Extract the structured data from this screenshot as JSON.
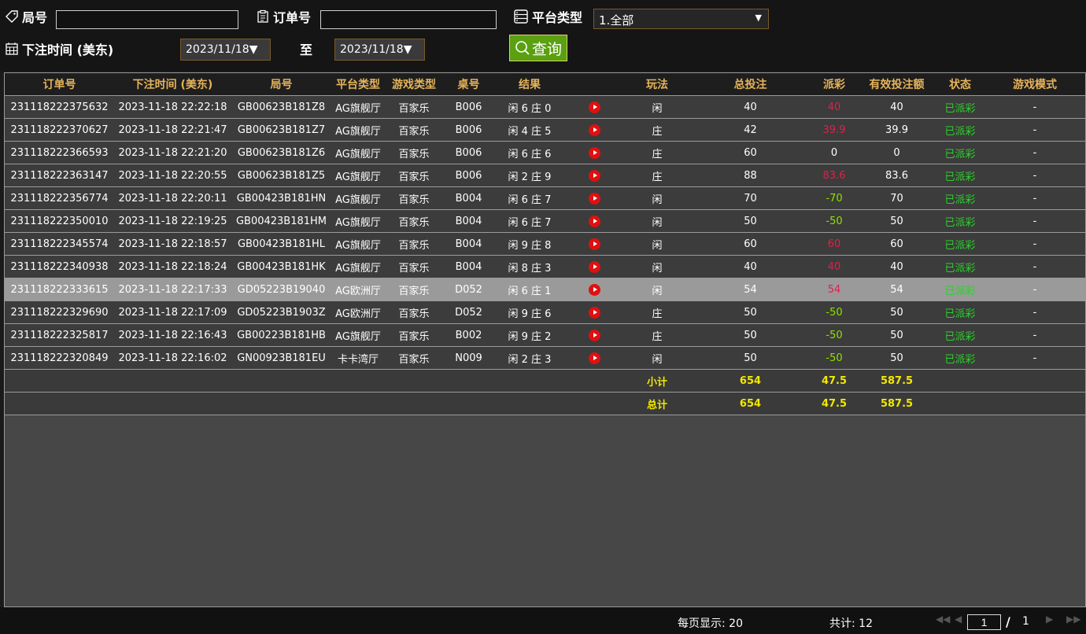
{
  "filters": {
    "round_label": "局号",
    "round_value": "",
    "order_label": "订单号",
    "order_value": "",
    "platform_label": "平台类型",
    "platform_selected": "1.全部",
    "time_label": "下注时间 (美东)",
    "date_from": "2023/11/18▼",
    "to_label": "至",
    "date_to": "2023/11/18▼",
    "query_label": "查询"
  },
  "columns": [
    "订单号",
    "下注时间 (美东)",
    "局号",
    "平台类型",
    "游戏类型",
    "桌号",
    "结果",
    "",
    "玩法",
    "总投注",
    "派彩",
    "有效投注额",
    "状态",
    "游戏模式"
  ],
  "rows": [
    {
      "order": "231118222375632",
      "time": "2023-11-18 22:22:18",
      "round": "GB00623B181Z8",
      "platform": "AG旗舰厅",
      "game": "百家乐",
      "table": "B006",
      "result": "闲 6 庄 0",
      "play": "闲",
      "bet": "40",
      "payout": "40",
      "valid": "40",
      "status": "已派彩",
      "mode": "-"
    },
    {
      "order": "231118222370627",
      "time": "2023-11-18 22:21:47",
      "round": "GB00623B181Z7",
      "platform": "AG旗舰厅",
      "game": "百家乐",
      "table": "B006",
      "result": "闲 4 庄 5",
      "play": "庄",
      "bet": "42",
      "payout": "39.9",
      "valid": "39.9",
      "status": "已派彩",
      "mode": "-"
    },
    {
      "order": "231118222366593",
      "time": "2023-11-18 22:21:20",
      "round": "GB00623B181Z6",
      "platform": "AG旗舰厅",
      "game": "百家乐",
      "table": "B006",
      "result": "闲 6 庄 6",
      "play": "庄",
      "bet": "60",
      "payout": "0",
      "valid": "0",
      "status": "已派彩",
      "mode": "-"
    },
    {
      "order": "231118222363147",
      "time": "2023-11-18 22:20:55",
      "round": "GB00623B181Z5",
      "platform": "AG旗舰厅",
      "game": "百家乐",
      "table": "B006",
      "result": "闲 2 庄 9",
      "play": "庄",
      "bet": "88",
      "payout": "83.6",
      "valid": "83.6",
      "status": "已派彩",
      "mode": "-"
    },
    {
      "order": "231118222356774",
      "time": "2023-11-18 22:20:11",
      "round": "GB00423B181HN",
      "platform": "AG旗舰厅",
      "game": "百家乐",
      "table": "B004",
      "result": "闲 6 庄 7",
      "play": "闲",
      "bet": "70",
      "payout": "-70",
      "valid": "70",
      "status": "已派彩",
      "mode": "-"
    },
    {
      "order": "231118222350010",
      "time": "2023-11-18 22:19:25",
      "round": "GB00423B181HM",
      "platform": "AG旗舰厅",
      "game": "百家乐",
      "table": "B004",
      "result": "闲 6 庄 7",
      "play": "闲",
      "bet": "50",
      "payout": "-50",
      "valid": "50",
      "status": "已派彩",
      "mode": "-"
    },
    {
      "order": "231118222345574",
      "time": "2023-11-18 22:18:57",
      "round": "GB00423B181HL",
      "platform": "AG旗舰厅",
      "game": "百家乐",
      "table": "B004",
      "result": "闲 9 庄 8",
      "play": "闲",
      "bet": "60",
      "payout": "60",
      "valid": "60",
      "status": "已派彩",
      "mode": "-"
    },
    {
      "order": "231118222340938",
      "time": "2023-11-18 22:18:24",
      "round": "GB00423B181HK",
      "platform": "AG旗舰厅",
      "game": "百家乐",
      "table": "B004",
      "result": "闲 8 庄 3",
      "play": "闲",
      "bet": "40",
      "payout": "40",
      "valid": "40",
      "status": "已派彩",
      "mode": "-"
    },
    {
      "order": "231118222333615",
      "time": "2023-11-18 22:17:33",
      "round": "GD05223B19040",
      "platform": "AG欧洲厅",
      "game": "百家乐",
      "table": "D052",
      "result": "闲 6 庄 1",
      "play": "闲",
      "bet": "54",
      "payout": "54",
      "valid": "54",
      "status": "已派彩",
      "mode": "-"
    },
    {
      "order": "231118222329690",
      "time": "2023-11-18 22:17:09",
      "round": "GD05223B1903Z",
      "platform": "AG欧洲厅",
      "game": "百家乐",
      "table": "D052",
      "result": "闲 9 庄 6",
      "play": "庄",
      "bet": "50",
      "payout": "-50",
      "valid": "50",
      "status": "已派彩",
      "mode": "-"
    },
    {
      "order": "231118222325817",
      "time": "2023-11-18 22:16:43",
      "round": "GB00223B181HB",
      "platform": "AG旗舰厅",
      "game": "百家乐",
      "table": "B002",
      "result": "闲 9 庄 2",
      "play": "庄",
      "bet": "50",
      "payout": "-50",
      "valid": "50",
      "status": "已派彩",
      "mode": "-"
    },
    {
      "order": "231118222320849",
      "time": "2023-11-18 22:16:02",
      "round": "GN00923B181EU",
      "platform": "卡卡湾厅",
      "game": "百家乐",
      "table": "N009",
      "result": "闲 2 庄 3",
      "play": "闲",
      "bet": "50",
      "payout": "-50",
      "valid": "50",
      "status": "已派彩",
      "mode": "-"
    }
  ],
  "selected_row": 8,
  "subtotal": {
    "label": "小计",
    "bet": "654",
    "payout": "47.5",
    "valid": "587.5"
  },
  "total": {
    "label": "总计",
    "bet": "654",
    "payout": "47.5",
    "valid": "587.5"
  },
  "footer": {
    "per_page": "每页显示: 20",
    "count": "共计: 12",
    "page_current": "1",
    "page_sep": "/",
    "page_total": "1"
  },
  "colors": {
    "header_text": "#e6b35a",
    "win": "#e0204a",
    "loss": "#8fe000",
    "status": "#2cd02c",
    "summary": "#f2e800",
    "query_button": "#5aa010"
  }
}
